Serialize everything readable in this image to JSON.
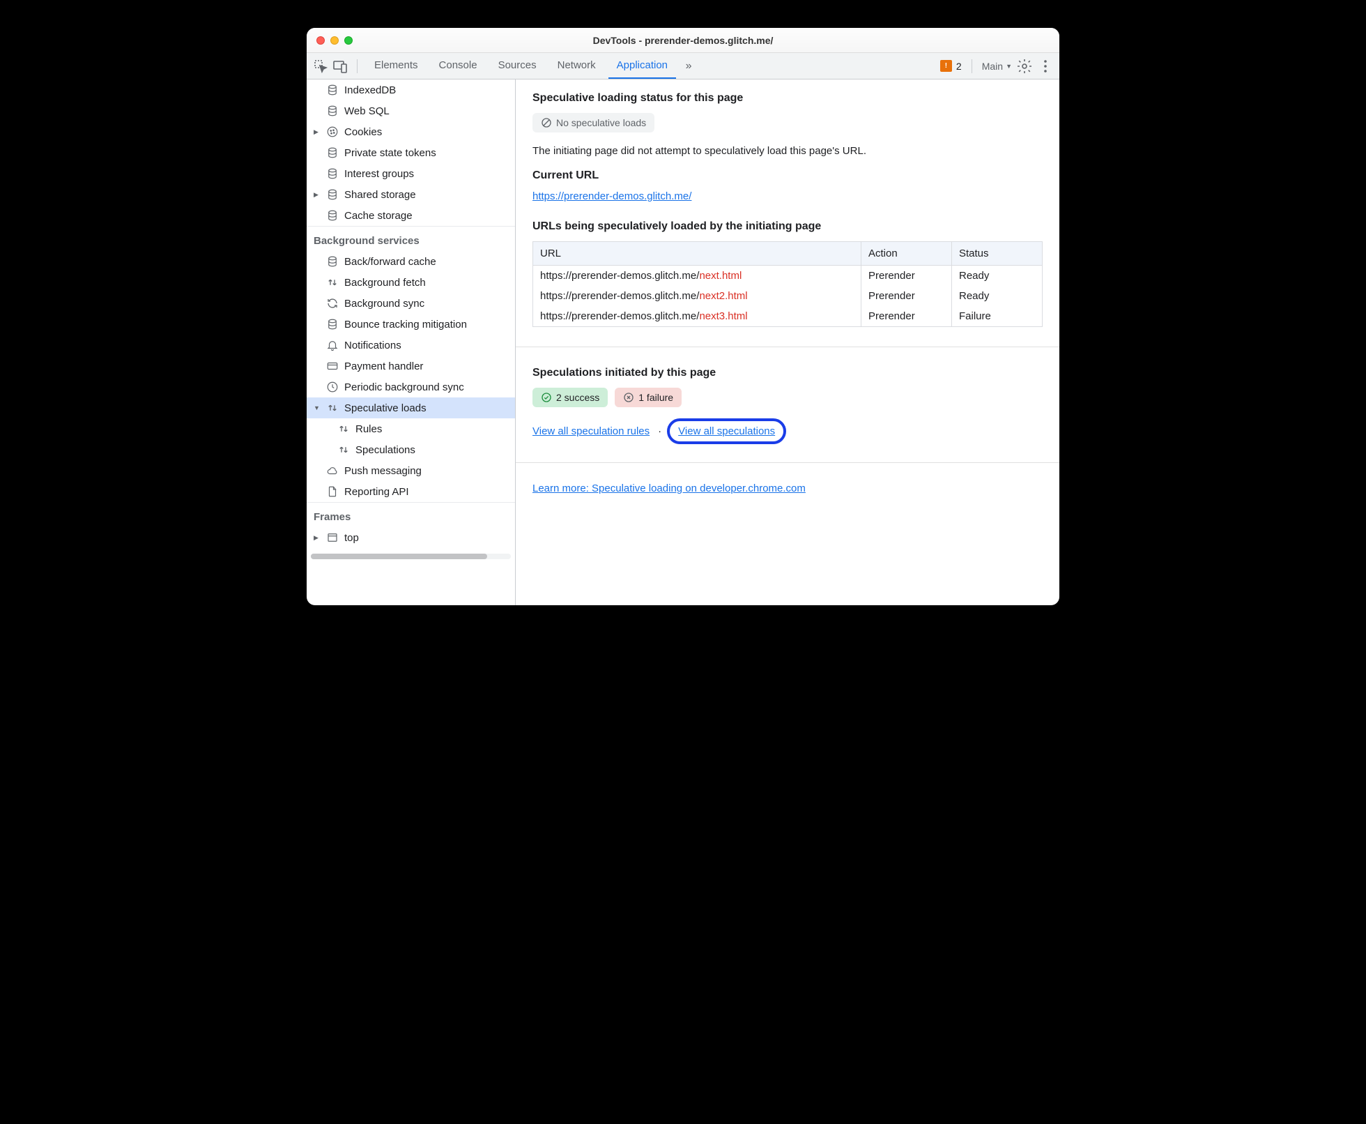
{
  "window": {
    "title": "DevTools - prerender-demos.glitch.me/"
  },
  "toolbar": {
    "tabs": [
      "Elements",
      "Console",
      "Sources",
      "Network",
      "Application"
    ],
    "active_tab": "Application",
    "warning_count": "2",
    "frame_label": "Main"
  },
  "sidebar": {
    "storage_items": [
      {
        "label": "IndexedDB",
        "icon": "db"
      },
      {
        "label": "Web SQL",
        "icon": "db"
      },
      {
        "label": "Cookies",
        "icon": "cookie",
        "expandable": true
      },
      {
        "label": "Private state tokens",
        "icon": "db"
      },
      {
        "label": "Interest groups",
        "icon": "db"
      },
      {
        "label": "Shared storage",
        "icon": "db",
        "expandable": true
      },
      {
        "label": "Cache storage",
        "icon": "db"
      }
    ],
    "background_header": "Background services",
    "background_items": [
      {
        "label": "Back/forward cache",
        "icon": "db"
      },
      {
        "label": "Background fetch",
        "icon": "updown"
      },
      {
        "label": "Background sync",
        "icon": "sync"
      },
      {
        "label": "Bounce tracking mitigation",
        "icon": "db"
      },
      {
        "label": "Notifications",
        "icon": "bell"
      },
      {
        "label": "Payment handler",
        "icon": "card"
      },
      {
        "label": "Periodic background sync",
        "icon": "clock"
      },
      {
        "label": "Speculative loads",
        "icon": "updown",
        "expanded": true,
        "selected": true
      },
      {
        "label": "Rules",
        "icon": "updown",
        "child": true
      },
      {
        "label": "Speculations",
        "icon": "updown",
        "child": true
      },
      {
        "label": "Push messaging",
        "icon": "cloud"
      },
      {
        "label": "Reporting API",
        "icon": "file"
      }
    ],
    "frames_header": "Frames",
    "frames_items": [
      {
        "label": "top",
        "icon": "window",
        "expandable": true
      }
    ]
  },
  "panel": {
    "status_heading": "Speculative loading status for this page",
    "status_badge": "No speculative loads",
    "status_desc": "The initiating page did not attempt to speculatively load this page's URL.",
    "current_url_heading": "Current URL",
    "current_url": "https://prerender-demos.glitch.me/",
    "urls_heading": "URLs being speculatively loaded by the initiating page",
    "table": {
      "headers": [
        "URL",
        "Action",
        "Status"
      ],
      "rows": [
        {
          "base": "https://prerender-demos.glitch.me/",
          "file": "next.html",
          "action": "Prerender",
          "status": "Ready"
        },
        {
          "base": "https://prerender-demos.glitch.me/",
          "file": "next2.html",
          "action": "Prerender",
          "status": "Ready"
        },
        {
          "base": "https://prerender-demos.glitch.me/",
          "file": "next3.html",
          "action": "Prerender",
          "status": "Failure"
        }
      ]
    },
    "speculations_heading": "Speculations initiated by this page",
    "success_pill": "2 success",
    "failure_pill": "1 failure",
    "link_rules": "View all speculation rules",
    "link_speculations": "View all speculations",
    "learn_more": "Learn more: Speculative loading on developer.chrome.com"
  }
}
